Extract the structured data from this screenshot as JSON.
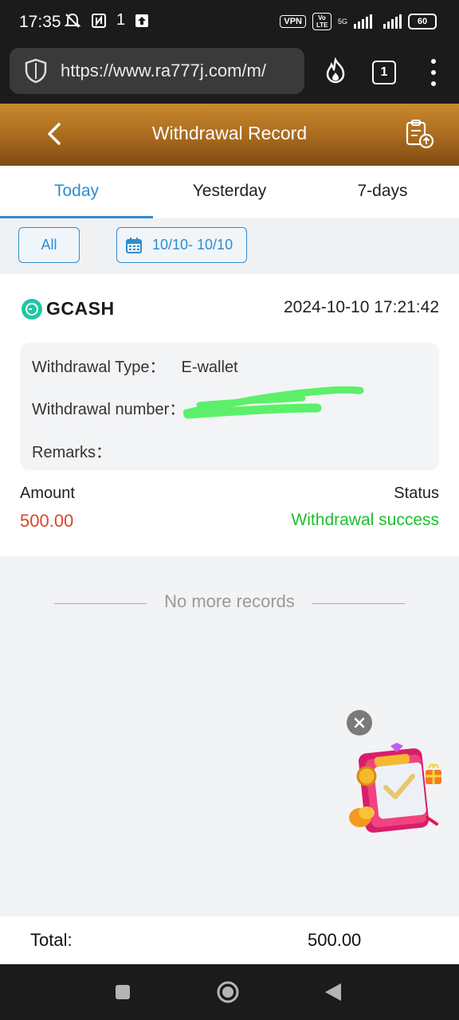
{
  "status_bar": {
    "time": "17:35",
    "left_icons": [
      "mute-bell-icon",
      "nfc-icon",
      "1",
      "upload-icon"
    ],
    "vpn_label": "VPN",
    "volte_label": "Vo LTE",
    "network_label": "5G",
    "battery_level": "60"
  },
  "browser": {
    "url": "https://www.ra777j.com/m/",
    "tab_count": "1"
  },
  "header": {
    "title": "Withdrawal Record"
  },
  "tabs": [
    {
      "label": "Today",
      "active": true
    },
    {
      "label": "Yesterday",
      "active": false
    },
    {
      "label": "7-days",
      "active": false
    }
  ],
  "filters": {
    "all_label": "All",
    "date_range": "10/10- 10/10"
  },
  "record": {
    "method": "GCASH",
    "datetime": "2024-10-10 17:21:42",
    "type_label": "Withdrawal Type：",
    "type_value": "E-wallet",
    "number_label": "Withdrawal number：",
    "number_value": "3",
    "remarks_label": "Remarks：",
    "remarks_value": "",
    "amount_label": "Amount",
    "amount_value": "500.00",
    "status_label": "Status",
    "status_value": "Withdrawal success"
  },
  "list_end": {
    "text": "No more records"
  },
  "footer": {
    "total_label": "Total:",
    "total_value": "500.00"
  },
  "colors": {
    "accent": "#2f8ccf",
    "header_gold": "#b07220",
    "amount_red": "#e0432a",
    "success_green": "#1cbf2e"
  }
}
